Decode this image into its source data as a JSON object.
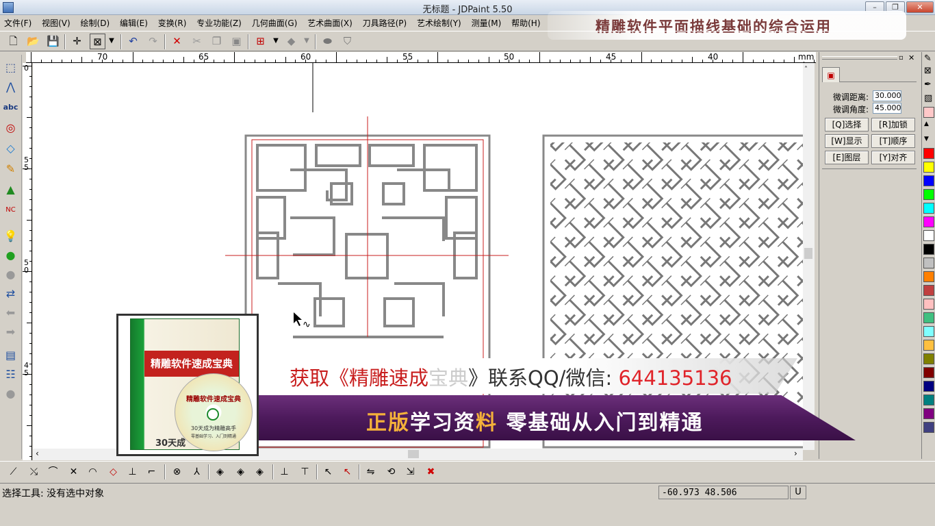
{
  "window": {
    "title": "无标题 - JDPaint 5.50"
  },
  "menu": [
    "文件(F)",
    "视图(V)",
    "绘制(D)",
    "编辑(E)",
    "变换(R)",
    "专业功能(Z)",
    "几何曲面(G)",
    "艺术曲面(X)",
    "刀具路径(P)",
    "艺术绘制(Y)",
    "测量(M)",
    "帮助(H)"
  ],
  "banner_top": "精雕软件平面描线基础的综合运用",
  "ruler": {
    "unit": "mm",
    "h_labels": [
      "70",
      "65",
      "60",
      "55",
      "50",
      "45",
      "40"
    ],
    "v_labels": [
      "0",
      "5\n5",
      "5\n0",
      "4\n5"
    ]
  },
  "panel": {
    "offset_label": "微调距离:",
    "offset_value": "30.000",
    "angle_label": "微调角度:",
    "angle_value": "45.000",
    "buttons": [
      "[Q]选择",
      "[R]加锁",
      "[W]显示",
      "[T]顺序",
      "[E]图层",
      "[Y]对齐"
    ]
  },
  "palette": [
    "#ff0000",
    "#ffff00",
    "#0000ff",
    "#00ff00",
    "#00ffff",
    "#ff00ff",
    "#ffffff",
    "#000000",
    "#c0c0c0",
    "#ff8000",
    "#c04040",
    "#ffc0c0",
    "#40c080",
    "#80ffff",
    "#ffc040",
    "#808000",
    "#800000",
    "#000080",
    "#008080",
    "#800080",
    "#404080"
  ],
  "status": {
    "text": "选择工具: 没有选中对象",
    "coords": "-60.973 48.506",
    "unit_button": "U"
  },
  "promo": {
    "line1_prefix": "获取《精雕速成",
    "line1_mid": "宝典",
    "line1_suffix": "》联系QQ/微信: ",
    "line1_number": "644135136",
    "line2_a": "正版",
    "line2_b": "学习资",
    "line2_c": "料",
    "line2_d": " 零基础从入门到精通",
    "book_title": "精雕软件速成宝典",
    "book_foot": "30天成",
    "disc_title": "精雕软件速成宝典",
    "disc_sub": "30天成为精雕高手",
    "disc_small": "零基础学习、入门到精通"
  },
  "colors": {
    "accent_red": "#c81e1e",
    "promo_purple": "#4d1a5c",
    "number_red": "#e0242a"
  }
}
